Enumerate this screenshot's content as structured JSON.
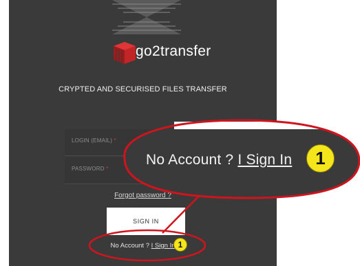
{
  "app": {
    "name": "go2transfer",
    "tagline": "CRYPTED AND SECURISED FILES TRANSFER"
  },
  "form": {
    "login_label": "LOGIN (EMAIL)",
    "password_label": "PASSWORD",
    "required_mark": "*",
    "forgot_label": "Forgot password ?",
    "signin_label": "SIGN IN",
    "no_account_text": "No Account ?",
    "signup_link": "I Sign In"
  },
  "annotation": {
    "callout_text": "No Account ?",
    "callout_link": "I Sign In",
    "badge_number": "1"
  },
  "colors": {
    "panel_bg": "#3a3a3a",
    "ellipse_red": "#d0141e",
    "badge_yellow": "#f5e51b"
  },
  "icons": {
    "logo": "red-cube-logo-icon"
  }
}
